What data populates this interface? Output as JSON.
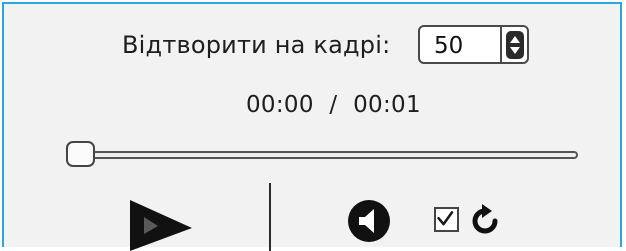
{
  "frame_control": {
    "label": "Відтворити на кадрі:",
    "value": "50"
  },
  "timecode": {
    "current": "00:00",
    "separator": "/",
    "total": "00:01"
  },
  "seek_slider": {
    "position": 0
  },
  "controls": {
    "play_icon": "play-icon",
    "mute_icon": "speaker-icon",
    "loop_checked": true,
    "loop_icon": "loop-icon"
  },
  "colors": {
    "panel_border": "#29a9e0",
    "panel_background": "#f2f2f2"
  }
}
